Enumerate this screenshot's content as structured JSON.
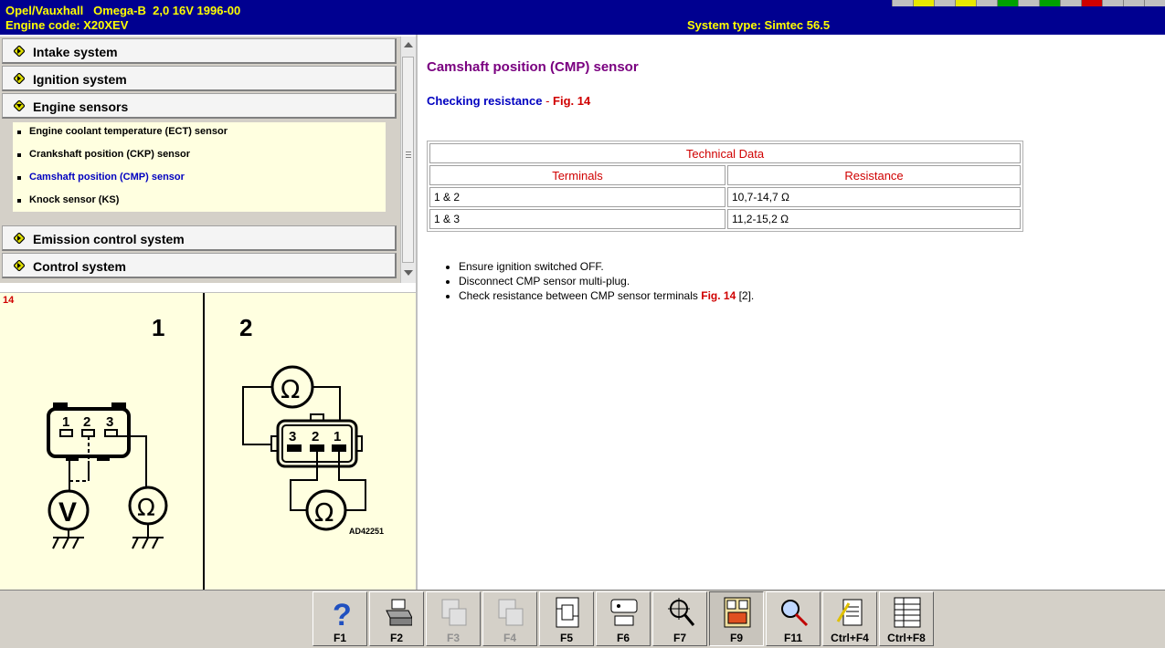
{
  "header": {
    "vehicle": "Opel/Vauxhall   Omega-B  2,0 16V 1996-00",
    "engine_code": "Engine code: X20XEV",
    "system_type": "System type: Simtec 56.5"
  },
  "menu": {
    "categories": [
      {
        "label": "Intake system"
      },
      {
        "label": "Ignition system"
      },
      {
        "label": "Engine sensors"
      },
      {
        "label": "Emission control system"
      },
      {
        "label": "Control system"
      }
    ],
    "sub_items": [
      {
        "label": "Engine coolant temperature (ECT) sensor"
      },
      {
        "label": "Crankshaft position (CKP) sensor"
      },
      {
        "label": "Camshaft position (CMP) sensor"
      },
      {
        "label": "Knock sensor (KS)"
      }
    ],
    "active_sub_item": "Camshaft position (CMP) sensor"
  },
  "figure": {
    "number": "14",
    "panel_1": "1",
    "panel_2": "2",
    "pins_left": [
      "1",
      "2",
      "3"
    ],
    "pins_right": [
      "3",
      "2",
      "1"
    ],
    "meter_v": "V",
    "meter_ohm": "Ω",
    "code": "AD42251"
  },
  "content": {
    "title": "Camshaft position (CMP) sensor",
    "check_label": "Checking resistance",
    "check_sep": " - ",
    "check_fig": "Fig. 14",
    "table": {
      "caption": "Technical Data",
      "col1": "Terminals",
      "col2": "Resistance",
      "rows": [
        {
          "terminals": "1 & 2",
          "resistance": "10,7-14,7 Ω"
        },
        {
          "terminals": "1 & 3",
          "resistance": "11,2-15,2 Ω"
        }
      ]
    },
    "steps": [
      "Ensure ignition switched OFF.",
      "Disconnect CMP sensor multi-plug.",
      "Check resistance between CMP sensor terminals"
    ],
    "step3_fig": "Fig. 14",
    "step3_tail": " [2]."
  },
  "footer": {
    "buttons": [
      {
        "key": "F1",
        "icon": "help-icon"
      },
      {
        "key": "F2",
        "icon": "printer-icon"
      },
      {
        "key": "F3",
        "icon": "component-icon",
        "disabled": true
      },
      {
        "key": "F4",
        "icon": "component-icon",
        "disabled": true
      },
      {
        "key": "F5",
        "icon": "wiring-icon"
      },
      {
        "key": "F6",
        "icon": "connector-icon"
      },
      {
        "key": "F7",
        "icon": "location-icon"
      },
      {
        "key": "F9",
        "icon": "fuse-icon"
      },
      {
        "key": "F11",
        "icon": "search-icon"
      },
      {
        "key": "Ctrl+F4",
        "icon": "notes-icon"
      },
      {
        "key": "Ctrl+F8",
        "icon": "list-icon"
      }
    ]
  },
  "colors": {
    "header_bg": "#000090",
    "header_text": "#ffff00",
    "title": "#7a0080",
    "link": "#0000c0",
    "red": "#d00000",
    "panel_bg": "#ffffe0"
  }
}
